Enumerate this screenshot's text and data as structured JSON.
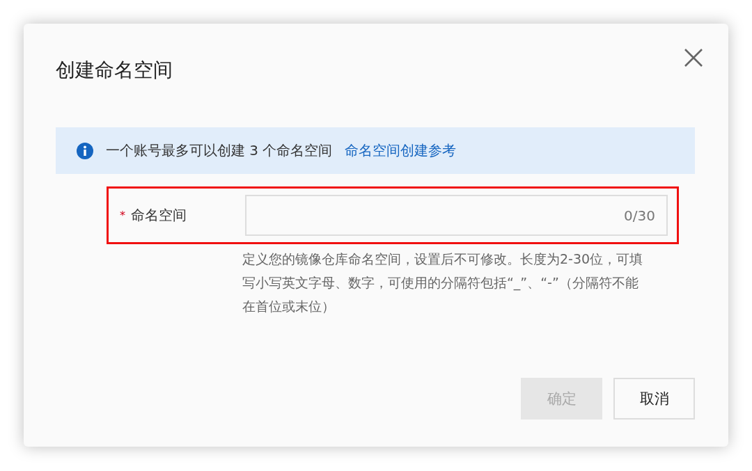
{
  "dialog": {
    "title": "创建命名空间"
  },
  "notice": {
    "text": "一个账号最多可以创建 3 个命名空间",
    "link": "命名空间创建参考"
  },
  "field": {
    "label": "命名空间",
    "required_mark": "*",
    "highlighted": true,
    "counter": "0/30",
    "hint": "定义您的镜像仓库命名空间，设置后不可修改。长度为2-30位，可填写小写英文字母、数字，可使用的分隔符包括“_”、“-”（分隔符不能在首位或末位）"
  },
  "buttons": [
    {
      "label": "确定",
      "disabled": true
    },
    {
      "label": "取消",
      "disabled": false
    }
  ]
}
